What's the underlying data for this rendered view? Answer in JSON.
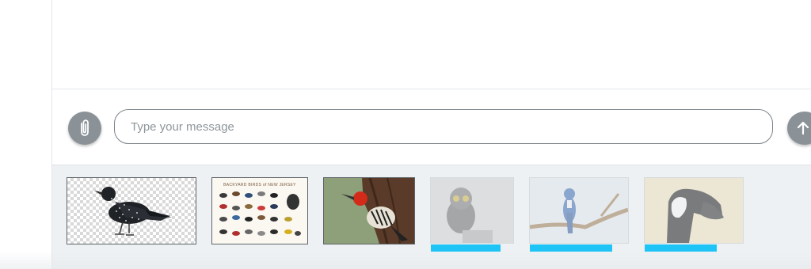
{
  "composer": {
    "placeholder": "Type your message",
    "attach_icon": "paperclip-icon",
    "send_icon": "arrow-up-icon"
  },
  "attachments": [
    {
      "name": "starling",
      "status": "uploaded"
    },
    {
      "name": "bird-poster",
      "status": "uploaded",
      "caption": "BACKYARD BIRDS of NEW JERSEY"
    },
    {
      "name": "woodpecker",
      "status": "uploaded"
    },
    {
      "name": "owl",
      "status": "uploading",
      "progress": 0.85
    },
    {
      "name": "blue-jay",
      "status": "uploading",
      "progress": 0.85
    },
    {
      "name": "goose",
      "status": "uploading",
      "progress": 0.75
    }
  ],
  "colors": {
    "button_gray": "#8a9298",
    "progress": "#1ec4f5",
    "tray": "#eef1f3"
  }
}
